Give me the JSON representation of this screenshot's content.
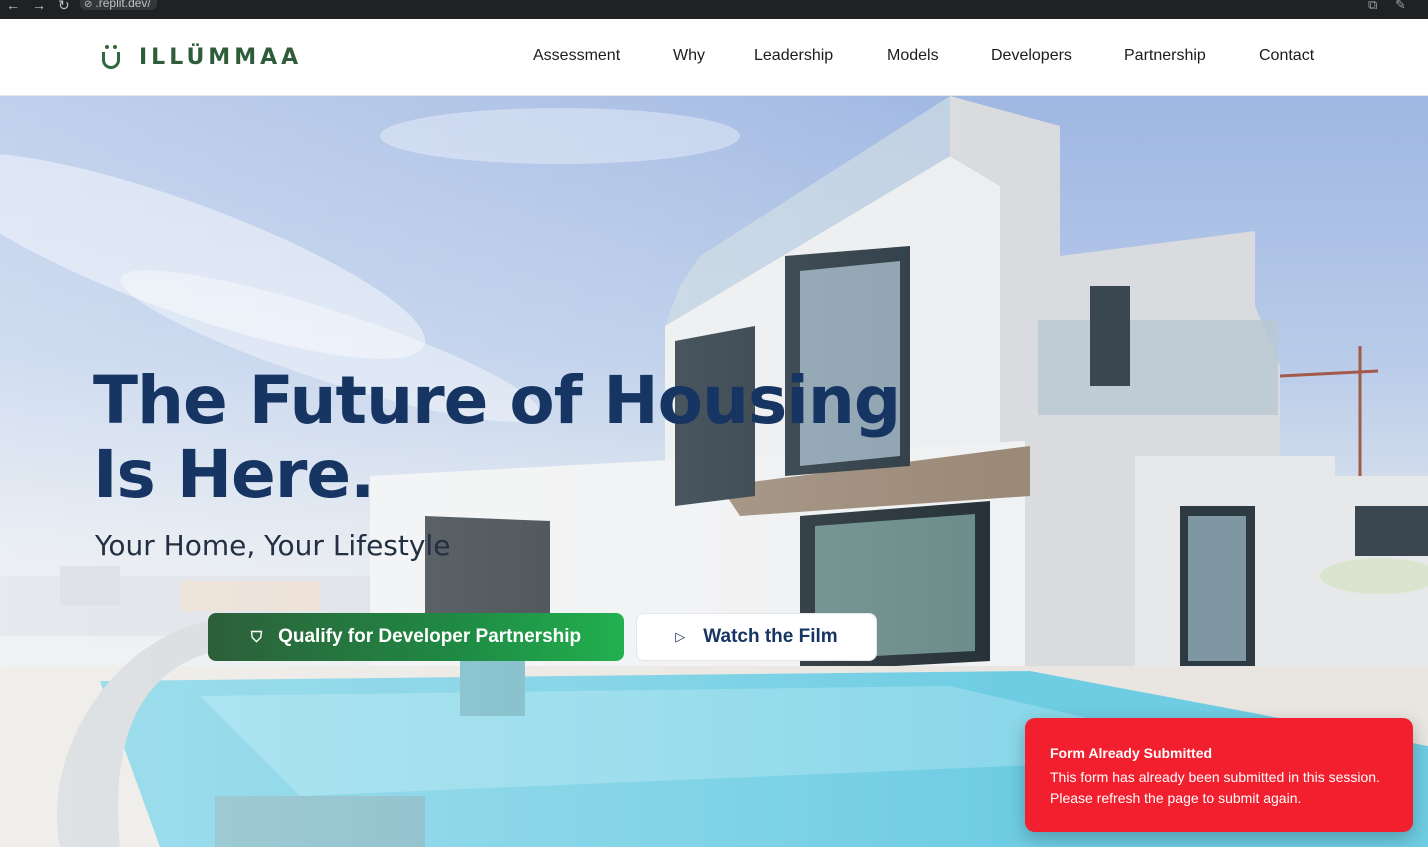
{
  "browser": {
    "url": ".replit.dev/",
    "back_icon": "back-arrow-icon",
    "forward_icon": "forward-arrow-icon",
    "reload_icon": "reload-icon"
  },
  "header": {
    "logo_text": "ILLÜMMAA",
    "nav": [
      "Assessment",
      "Why",
      "Leadership",
      "Models",
      "Developers",
      "Partnership",
      "Contact"
    ]
  },
  "hero": {
    "headline_line1": "The Future of Housing",
    "headline_line2": "Is Here.",
    "subheadline": "Your Home, Your Lifestyle",
    "primary_cta": "Qualify for Developer Partnership",
    "secondary_cta": "Watch the Film"
  },
  "toast": {
    "title": "Form Already Submitted",
    "message": "This form has already been submitted in this session. Please refresh the page to submit again."
  },
  "colors": {
    "brand_green": "#2d6a3e",
    "headline_navy": "#173563",
    "toast_red": "#f21f2e"
  }
}
